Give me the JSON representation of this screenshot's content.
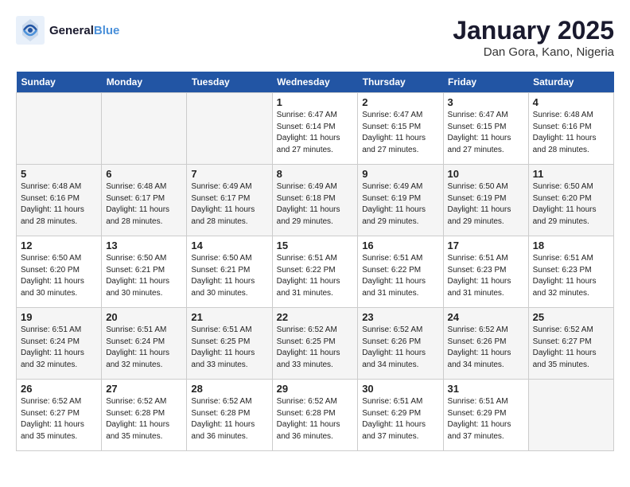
{
  "header": {
    "logo_line1": "General",
    "logo_line2": "Blue",
    "month": "January 2025",
    "location": "Dan Gora, Kano, Nigeria"
  },
  "weekdays": [
    "Sunday",
    "Monday",
    "Tuesday",
    "Wednesday",
    "Thursday",
    "Friday",
    "Saturday"
  ],
  "weeks": [
    [
      {
        "day": "",
        "info": ""
      },
      {
        "day": "",
        "info": ""
      },
      {
        "day": "",
        "info": ""
      },
      {
        "day": "1",
        "info": "Sunrise: 6:47 AM\nSunset: 6:14 PM\nDaylight: 11 hours\nand 27 minutes."
      },
      {
        "day": "2",
        "info": "Sunrise: 6:47 AM\nSunset: 6:15 PM\nDaylight: 11 hours\nand 27 minutes."
      },
      {
        "day": "3",
        "info": "Sunrise: 6:47 AM\nSunset: 6:15 PM\nDaylight: 11 hours\nand 27 minutes."
      },
      {
        "day": "4",
        "info": "Sunrise: 6:48 AM\nSunset: 6:16 PM\nDaylight: 11 hours\nand 28 minutes."
      }
    ],
    [
      {
        "day": "5",
        "info": "Sunrise: 6:48 AM\nSunset: 6:16 PM\nDaylight: 11 hours\nand 28 minutes."
      },
      {
        "day": "6",
        "info": "Sunrise: 6:48 AM\nSunset: 6:17 PM\nDaylight: 11 hours\nand 28 minutes."
      },
      {
        "day": "7",
        "info": "Sunrise: 6:49 AM\nSunset: 6:17 PM\nDaylight: 11 hours\nand 28 minutes."
      },
      {
        "day": "8",
        "info": "Sunrise: 6:49 AM\nSunset: 6:18 PM\nDaylight: 11 hours\nand 29 minutes."
      },
      {
        "day": "9",
        "info": "Sunrise: 6:49 AM\nSunset: 6:19 PM\nDaylight: 11 hours\nand 29 minutes."
      },
      {
        "day": "10",
        "info": "Sunrise: 6:50 AM\nSunset: 6:19 PM\nDaylight: 11 hours\nand 29 minutes."
      },
      {
        "day": "11",
        "info": "Sunrise: 6:50 AM\nSunset: 6:20 PM\nDaylight: 11 hours\nand 29 minutes."
      }
    ],
    [
      {
        "day": "12",
        "info": "Sunrise: 6:50 AM\nSunset: 6:20 PM\nDaylight: 11 hours\nand 30 minutes."
      },
      {
        "day": "13",
        "info": "Sunrise: 6:50 AM\nSunset: 6:21 PM\nDaylight: 11 hours\nand 30 minutes."
      },
      {
        "day": "14",
        "info": "Sunrise: 6:50 AM\nSunset: 6:21 PM\nDaylight: 11 hours\nand 30 minutes."
      },
      {
        "day": "15",
        "info": "Sunrise: 6:51 AM\nSunset: 6:22 PM\nDaylight: 11 hours\nand 31 minutes."
      },
      {
        "day": "16",
        "info": "Sunrise: 6:51 AM\nSunset: 6:22 PM\nDaylight: 11 hours\nand 31 minutes."
      },
      {
        "day": "17",
        "info": "Sunrise: 6:51 AM\nSunset: 6:23 PM\nDaylight: 11 hours\nand 31 minutes."
      },
      {
        "day": "18",
        "info": "Sunrise: 6:51 AM\nSunset: 6:23 PM\nDaylight: 11 hours\nand 32 minutes."
      }
    ],
    [
      {
        "day": "19",
        "info": "Sunrise: 6:51 AM\nSunset: 6:24 PM\nDaylight: 11 hours\nand 32 minutes."
      },
      {
        "day": "20",
        "info": "Sunrise: 6:51 AM\nSunset: 6:24 PM\nDaylight: 11 hours\nand 32 minutes."
      },
      {
        "day": "21",
        "info": "Sunrise: 6:51 AM\nSunset: 6:25 PM\nDaylight: 11 hours\nand 33 minutes."
      },
      {
        "day": "22",
        "info": "Sunrise: 6:52 AM\nSunset: 6:25 PM\nDaylight: 11 hours\nand 33 minutes."
      },
      {
        "day": "23",
        "info": "Sunrise: 6:52 AM\nSunset: 6:26 PM\nDaylight: 11 hours\nand 34 minutes."
      },
      {
        "day": "24",
        "info": "Sunrise: 6:52 AM\nSunset: 6:26 PM\nDaylight: 11 hours\nand 34 minutes."
      },
      {
        "day": "25",
        "info": "Sunrise: 6:52 AM\nSunset: 6:27 PM\nDaylight: 11 hours\nand 35 minutes."
      }
    ],
    [
      {
        "day": "26",
        "info": "Sunrise: 6:52 AM\nSunset: 6:27 PM\nDaylight: 11 hours\nand 35 minutes."
      },
      {
        "day": "27",
        "info": "Sunrise: 6:52 AM\nSunset: 6:28 PM\nDaylight: 11 hours\nand 35 minutes."
      },
      {
        "day": "28",
        "info": "Sunrise: 6:52 AM\nSunset: 6:28 PM\nDaylight: 11 hours\nand 36 minutes."
      },
      {
        "day": "29",
        "info": "Sunrise: 6:52 AM\nSunset: 6:28 PM\nDaylight: 11 hours\nand 36 minutes."
      },
      {
        "day": "30",
        "info": "Sunrise: 6:51 AM\nSunset: 6:29 PM\nDaylight: 11 hours\nand 37 minutes."
      },
      {
        "day": "31",
        "info": "Sunrise: 6:51 AM\nSunset: 6:29 PM\nDaylight: 11 hours\nand 37 minutes."
      },
      {
        "day": "",
        "info": ""
      }
    ]
  ]
}
